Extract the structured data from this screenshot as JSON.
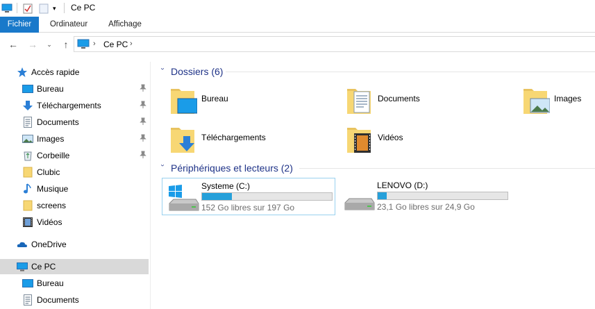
{
  "window": {
    "title": "Ce PC"
  },
  "ribbon": {
    "tabs": [
      {
        "label": "Fichier",
        "active": true
      },
      {
        "label": "Ordinateur",
        "active": false
      },
      {
        "label": "Affichage",
        "active": false
      }
    ]
  },
  "address": {
    "crumb": "Ce PC"
  },
  "sidebar": {
    "quick_access": "Accès rapide",
    "pinned": [
      {
        "label": "Bureau",
        "icon": "desktop-icon",
        "pinned": true
      },
      {
        "label": "Téléchargements",
        "icon": "download-icon",
        "pinned": true
      },
      {
        "label": "Documents",
        "icon": "documents-icon",
        "pinned": true
      },
      {
        "label": "Images",
        "icon": "images-icon",
        "pinned": true
      },
      {
        "label": "Corbeille",
        "icon": "recycle-bin-icon",
        "pinned": true
      },
      {
        "label": "Clubic",
        "icon": "folder-icon",
        "pinned": false
      },
      {
        "label": "Musique",
        "icon": "music-icon",
        "pinned": false
      },
      {
        "label": "screens",
        "icon": "folder-icon",
        "pinned": false
      },
      {
        "label": "Vidéos",
        "icon": "videos-icon",
        "pinned": false
      }
    ],
    "onedrive": "OneDrive",
    "this_pc": "Ce PC",
    "this_pc_children": [
      {
        "label": "Bureau",
        "icon": "desktop-icon"
      },
      {
        "label": "Documents",
        "icon": "documents-icon"
      }
    ]
  },
  "content": {
    "folders_title": "Dossiers (6)",
    "folders": [
      {
        "label": "Bureau",
        "icon": "desktop-folder-icon"
      },
      {
        "label": "Documents",
        "icon": "documents-folder-icon"
      },
      {
        "label": "Images",
        "icon": "images-folder-icon"
      },
      {
        "label": "Téléchargements",
        "icon": "downloads-folder-icon"
      },
      {
        "label": "Vidéos",
        "icon": "videos-folder-icon"
      }
    ],
    "devices_title": "Périphériques et lecteurs (2)",
    "drives": [
      {
        "name": "Systeme (C:)",
        "free_text": "152 Go libres sur 197 Go",
        "used_fraction": 0.228,
        "icon": "windows-drive-icon"
      },
      {
        "name": "LENOVO (D:)",
        "free_text": "23,1 Go libres sur 24,9 Go",
        "used_fraction": 0.072,
        "icon": "hard-drive-icon"
      }
    ]
  },
  "colors": {
    "accent": "#1979ca",
    "section_title": "#1e3287",
    "selection": "#d9d9d9",
    "usage_bar": "#26a0da"
  }
}
